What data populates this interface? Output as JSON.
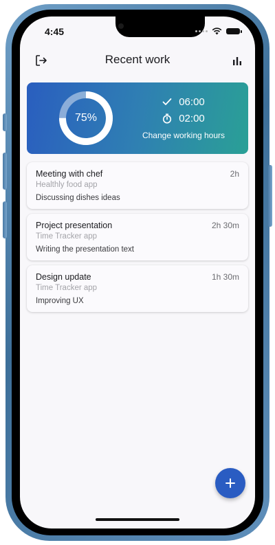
{
  "status_bar": {
    "time": "4:45"
  },
  "app_bar": {
    "title": "Recent work",
    "left_icon": "logout-icon",
    "right_icon": "bar-chart-icon"
  },
  "summary": {
    "progress_percent": 75,
    "progress_label": "75%",
    "done_time": "06:00",
    "timer_time": "02:00",
    "change_hours_label": "Change working hours"
  },
  "work_items": [
    {
      "title": "Meeting with chef",
      "project": "Healthly food app",
      "description": "Discussing dishes ideas",
      "duration": "2h"
    },
    {
      "title": "Project presentation",
      "project": "Time Tracker app",
      "description": "Writing the presentation text",
      "duration": "2h 30m"
    },
    {
      "title": "Design update",
      "project": "Time Tracker app",
      "description": "Improving UX",
      "duration": "1h 30m"
    }
  ],
  "fab": {
    "icon": "plus-icon"
  },
  "colors": {
    "accent": "#2a5cc2",
    "gradient_start": "#2a5ebf",
    "gradient_end": "#2aa096",
    "background": "#f8f7fa"
  }
}
